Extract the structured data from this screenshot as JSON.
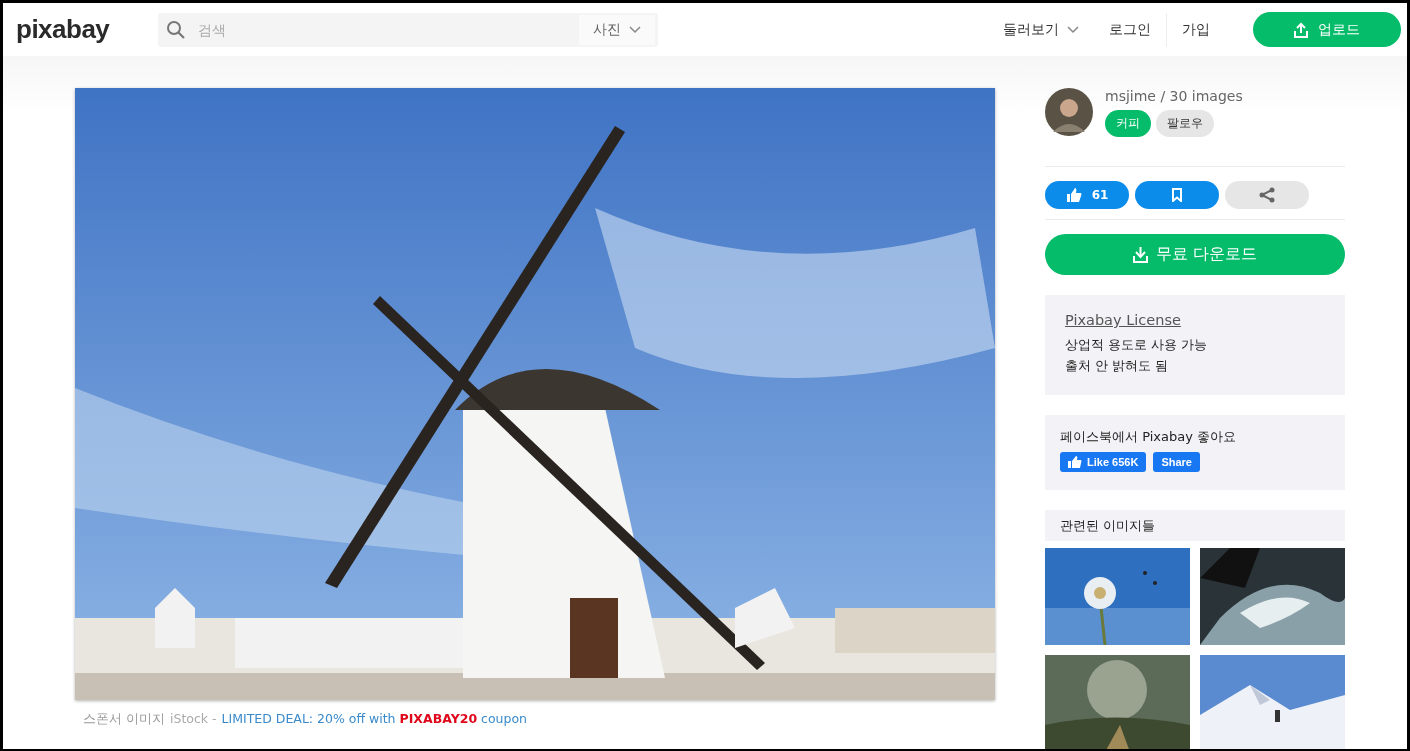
{
  "header": {
    "logo": "pixabay",
    "search": {
      "placeholder": "검색"
    },
    "search_type": "사진",
    "nav": [
      {
        "label": "둘러보기",
        "kind": "menu"
      },
      {
        "label": "로그인",
        "kind": "link"
      },
      {
        "label": "가입",
        "kind": "link"
      }
    ],
    "upload": "업로드"
  },
  "sponsor": {
    "label": "스폰서 이미지",
    "source": "iStock -",
    "deal": "LIMITED DEAL: 20% off with **PIXABAY20** coupon"
  },
  "author": {
    "name": "msjime / 30 images",
    "buttons": [
      {
        "label": "커피",
        "kind": "primary"
      },
      {
        "label": "팔로우",
        "kind": "secondary"
      }
    ]
  },
  "actions": {
    "likes": "61"
  },
  "download": "무료 다운로드",
  "license": {
    "title": "Pixabay License",
    "lines": [
      "상업적 용도로 사용 가능",
      "출처 안 밝혀도 됨"
    ]
  },
  "facebook": {
    "text": "페이스북에서 Pixabay 좋아요",
    "like": "Like 656K",
    "share": "Share"
  },
  "related": {
    "title": "관련된 이미지들",
    "images": [
      {
        "kind": "dandelion"
      },
      {
        "kind": "wave"
      },
      {
        "kind": "storm"
      },
      {
        "kind": "snow"
      }
    ]
  }
}
